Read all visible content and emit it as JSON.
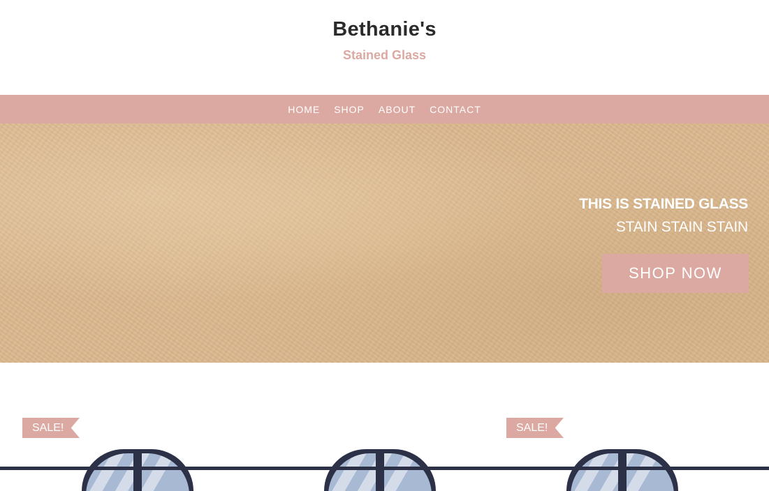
{
  "brand": {
    "name": "Bethanie's",
    "tagline": "Stained Glass"
  },
  "nav": {
    "items": [
      "HOME",
      "SHOP",
      "ABOUT",
      "CONTACT"
    ]
  },
  "hero": {
    "headline": "THIS IS STAINED GLASS",
    "subline": "STAIN STAIN STAIN",
    "cta_label": "SHOP NOW"
  },
  "products": [
    {
      "sale_label": "SALE!"
    },
    {
      "sale_label": ""
    },
    {
      "sale_label": "SALE!"
    }
  ],
  "colors": {
    "accent": "#dba9a1",
    "text_dark": "#2b2b2b",
    "hero_bg": "#dcb98f"
  }
}
